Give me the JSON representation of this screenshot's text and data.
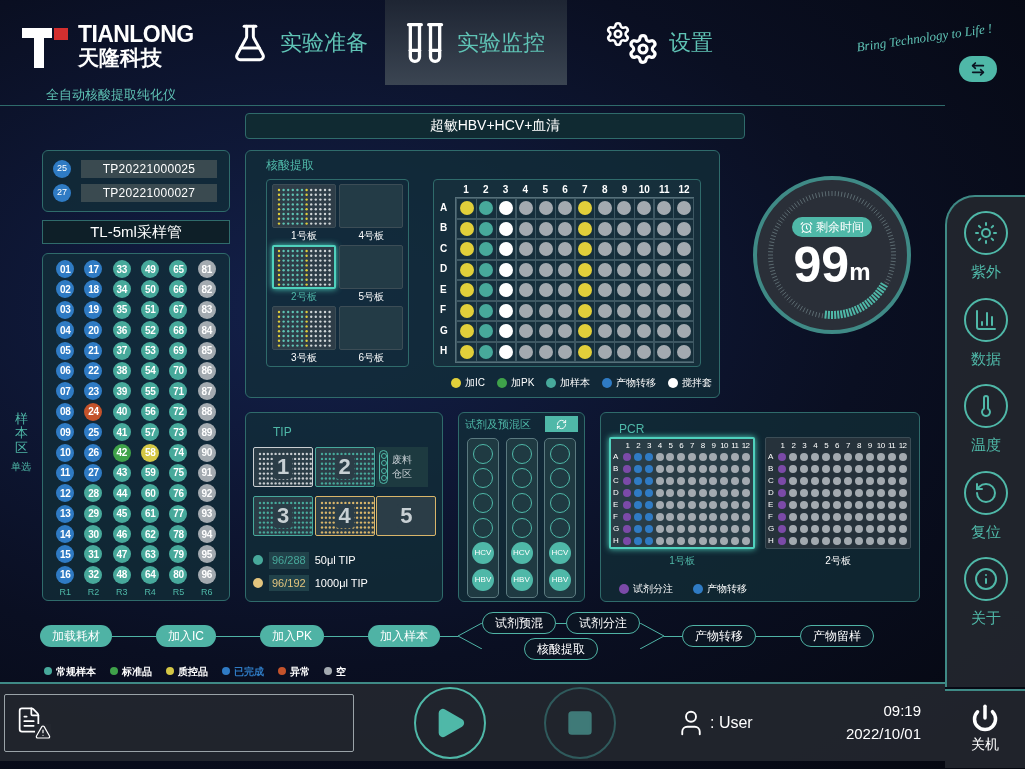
{
  "brand": {
    "name": "TIANLONG",
    "name_cn": "天隆科技",
    "tagline": "Bring Technology to Life !",
    "subtitle": "全自动核酸提取纯化仪"
  },
  "nav": [
    {
      "label": "实验准备",
      "kind": "flask",
      "selected": false
    },
    {
      "label": "实验监控",
      "kind": "tubes",
      "selected": true
    },
    {
      "label": "设置",
      "kind": "gears",
      "selected": false
    }
  ],
  "banner": "超敏HBV+HCV+血清",
  "barcodes": [
    {
      "number": "25",
      "code": "TP20221000025",
      "color": "#2f7bc4"
    },
    {
      "number": "27",
      "code": "TP20221000027",
      "color": "#2f7bc4"
    }
  ],
  "tube_type": "TL-5ml采样管",
  "samples": {
    "side_label": "样本区",
    "mode": "单选",
    "columns": [
      {
        "label": "R1",
        "wells": [
          {
            "label": "01",
            "color": "#2f7bc4"
          },
          {
            "label": "02",
            "color": "#2f7bc4"
          },
          {
            "label": "03",
            "color": "#2f7bc4"
          },
          {
            "label": "04",
            "color": "#2f7bc4"
          },
          {
            "label": "05",
            "color": "#2f7bc4"
          },
          {
            "label": "06",
            "color": "#2f7bc4"
          },
          {
            "label": "07",
            "color": "#2f7bc4"
          },
          {
            "label": "08",
            "color": "#2f7bc4"
          },
          {
            "label": "09",
            "color": "#2f7bc4"
          },
          {
            "label": "10",
            "color": "#2f7bc4"
          },
          {
            "label": "11",
            "color": "#2f7bc4"
          },
          {
            "label": "12",
            "color": "#2f7bc4"
          },
          {
            "label": "13",
            "color": "#2f7bc4"
          },
          {
            "label": "14",
            "color": "#2f7bc4"
          },
          {
            "label": "15",
            "color": "#2f7bc4"
          },
          {
            "label": "16",
            "color": "#2f7bc4"
          }
        ]
      },
      {
        "label": "R2",
        "wells": [
          {
            "label": "17",
            "color": "#2f7bc4"
          },
          {
            "label": "18",
            "color": "#2f7bc4"
          },
          {
            "label": "19",
            "color": "#2f7bc4"
          },
          {
            "label": "20",
            "color": "#2f7bc4"
          },
          {
            "label": "21",
            "color": "#2f7bc4"
          },
          {
            "label": "22",
            "color": "#2f7bc4"
          },
          {
            "label": "23",
            "color": "#2f7bc4"
          },
          {
            "label": "24",
            "color": "#c4532b"
          },
          {
            "label": "25",
            "color": "#2f7bc4"
          },
          {
            "label": "26",
            "color": "#2f7bc4"
          },
          {
            "label": "27",
            "color": "#2f7bc4"
          },
          {
            "label": "28",
            "color": "#47a99b"
          },
          {
            "label": "29",
            "color": "#47a99b"
          },
          {
            "label": "30",
            "color": "#47a99b"
          },
          {
            "label": "31",
            "color": "#47a99b"
          },
          {
            "label": "32",
            "color": "#47a99b"
          }
        ]
      },
      {
        "label": "R3",
        "wells": [
          {
            "label": "33",
            "color": "#47a99b"
          },
          {
            "label": "34",
            "color": "#47a99b"
          },
          {
            "label": "35",
            "color": "#47a99b"
          },
          {
            "label": "36",
            "color": "#47a99b"
          },
          {
            "label": "37",
            "color": "#47a99b"
          },
          {
            "label": "38",
            "color": "#47a99b"
          },
          {
            "label": "39",
            "color": "#47a99b"
          },
          {
            "label": "40",
            "color": "#47a99b"
          },
          {
            "label": "41",
            "color": "#47a99b"
          },
          {
            "label": "42",
            "color": "#3fa24a"
          },
          {
            "label": "43",
            "color": "#47a99b"
          },
          {
            "label": "44",
            "color": "#47a99b"
          },
          {
            "label": "45",
            "color": "#47a99b"
          },
          {
            "label": "46",
            "color": "#47a99b"
          },
          {
            "label": "47",
            "color": "#47a99b"
          },
          {
            "label": "48",
            "color": "#47a99b"
          }
        ]
      },
      {
        "label": "R4",
        "wells": [
          {
            "label": "49",
            "color": "#47a99b"
          },
          {
            "label": "50",
            "color": "#47a99b"
          },
          {
            "label": "51",
            "color": "#47a99b"
          },
          {
            "label": "52",
            "color": "#47a99b"
          },
          {
            "label": "53",
            "color": "#47a99b"
          },
          {
            "label": "54",
            "color": "#47a99b"
          },
          {
            "label": "55",
            "color": "#47a99b"
          },
          {
            "label": "56",
            "color": "#47a99b"
          },
          {
            "label": "57",
            "color": "#47a99b"
          },
          {
            "label": "58",
            "color": "#d4c745"
          },
          {
            "label": "59",
            "color": "#47a99b"
          },
          {
            "label": "60",
            "color": "#47a99b"
          },
          {
            "label": "61",
            "color": "#47a99b"
          },
          {
            "label": "62",
            "color": "#47a99b"
          },
          {
            "label": "63",
            "color": "#47a99b"
          },
          {
            "label": "64",
            "color": "#47a99b"
          }
        ]
      },
      {
        "label": "R5",
        "wells": [
          {
            "label": "65",
            "color": "#47a99b"
          },
          {
            "label": "66",
            "color": "#47a99b"
          },
          {
            "label": "67",
            "color": "#47a99b"
          },
          {
            "label": "68",
            "color": "#47a99b"
          },
          {
            "label": "69",
            "color": "#47a99b"
          },
          {
            "label": "70",
            "color": "#47a99b"
          },
          {
            "label": "71",
            "color": "#47a99b"
          },
          {
            "label": "72",
            "color": "#47a99b"
          },
          {
            "label": "73",
            "color": "#47a99b"
          },
          {
            "label": "74",
            "color": "#47a99b"
          },
          {
            "label": "75",
            "color": "#47a99b"
          },
          {
            "label": "76",
            "color": "#47a99b"
          },
          {
            "label": "77",
            "color": "#47a99b"
          },
          {
            "label": "78",
            "color": "#47a99b"
          },
          {
            "label": "79",
            "color": "#47a99b"
          },
          {
            "label": "80",
            "color": "#47a99b"
          }
        ]
      },
      {
        "label": "R6",
        "wells": [
          {
            "label": "81",
            "color": "#a3aab0"
          },
          {
            "label": "82",
            "color": "#a3aab0"
          },
          {
            "label": "83",
            "color": "#a3aab0"
          },
          {
            "label": "84",
            "color": "#a3aab0"
          },
          {
            "label": "85",
            "color": "#a3aab0"
          },
          {
            "label": "86",
            "color": "#a3aab0"
          },
          {
            "label": "87",
            "color": "#a3aab0"
          },
          {
            "label": "88",
            "color": "#a3aab0"
          },
          {
            "label": "89",
            "color": "#a3aab0"
          },
          {
            "label": "90",
            "color": "#a3aab0"
          },
          {
            "label": "91",
            "color": "#a3aab0"
          },
          {
            "label": "92",
            "color": "#a3aab0"
          },
          {
            "label": "93",
            "color": "#a3aab0"
          },
          {
            "label": "94",
            "color": "#a3aab0"
          },
          {
            "label": "95",
            "color": "#a3aab0"
          },
          {
            "label": "96",
            "color": "#a3aab0"
          }
        ]
      }
    ]
  },
  "extraction": {
    "title": "核酸提取",
    "plates": [
      {
        "label": "1号板",
        "loaded": true,
        "selected": false
      },
      {
        "label": "4号板",
        "loaded": false,
        "selected": false
      },
      {
        "label": "2号板",
        "loaded": true,
        "selected": true
      },
      {
        "label": "5号板",
        "loaded": false,
        "selected": false
      },
      {
        "label": "3号板",
        "loaded": true,
        "selected": false
      },
      {
        "label": "6号板",
        "loaded": false,
        "selected": false
      }
    ],
    "plate": {
      "rows": [
        "A",
        "B",
        "C",
        "D",
        "E",
        "F",
        "G",
        "H"
      ],
      "columns": [
        {
          "label": "1",
          "color": "#e1cf3a"
        },
        {
          "label": "2",
          "color": "#47a99b"
        },
        {
          "label": "3",
          "color": "#ffffff"
        },
        {
          "label": "4",
          "color": "#a3aab0"
        },
        {
          "label": "5",
          "color": "#a3aab0"
        },
        {
          "label": "6",
          "color": "#a3aab0"
        },
        {
          "label": "7",
          "color": "#e1cf3a"
        },
        {
          "label": "8",
          "color": "#a3aab0"
        },
        {
          "label": "9",
          "color": "#a3aab0"
        },
        {
          "label": "10",
          "color": "#a3aab0"
        },
        {
          "label": "11",
          "color": "#a3aab0"
        },
        {
          "label": "12",
          "color": "#a3aab0"
        }
      ]
    },
    "legend": [
      {
        "label": "加IC",
        "color": "#e1cf3a"
      },
      {
        "label": "加PK",
        "color": "#3fa24a"
      },
      {
        "label": "加样本",
        "color": "#47a99b"
      },
      {
        "label": "产物转移",
        "color": "#2f7bc4"
      },
      {
        "label": "搅拌套",
        "color": "#ffffff"
      }
    ]
  },
  "timer": {
    "label": "剩余时间",
    "value": "99",
    "unit": "m"
  },
  "tip": {
    "title": "TIP",
    "racks": [
      {
        "label": "1",
        "color": "#c9ced1",
        "loaded": true
      },
      {
        "label": "2",
        "color": "#47a99b",
        "loaded": true
      },
      {
        "label": "3",
        "color": "#47a99b",
        "loaded": true
      },
      {
        "label": "4",
        "color": "#d9b56a",
        "loaded": true
      },
      {
        "label": "5",
        "color": "#d9b56a",
        "loaded": false
      }
    ],
    "waste": "废料仓区",
    "legend": [
      {
        "count": "96/288",
        "label": "50μl TIP",
        "color": "#47a99b"
      },
      {
        "count": "96/192",
        "label": "1000μl TIP",
        "color": "#e3c57e"
      }
    ]
  },
  "reagent": {
    "title": "试剂及预混区",
    "strips": [
      {
        "slots": [
          {
            "kind": "empty"
          },
          {
            "kind": "empty"
          },
          {
            "kind": "empty"
          },
          {
            "kind": "empty"
          },
          {
            "kind": "reagent",
            "label": "HCV"
          },
          {
            "kind": "reagent",
            "label": "HBV"
          }
        ]
      },
      {
        "slots": [
          {
            "kind": "empty"
          },
          {
            "kind": "empty"
          },
          {
            "kind": "empty"
          },
          {
            "kind": "empty"
          },
          {
            "kind": "reagent",
            "label": "HCV"
          },
          {
            "kind": "reagent",
            "label": "HBV"
          }
        ]
      },
      {
        "slots": [
          {
            "kind": "empty"
          },
          {
            "kind": "empty"
          },
          {
            "kind": "empty"
          },
          {
            "kind": "empty"
          },
          {
            "kind": "reagent",
            "label": "HCV"
          },
          {
            "kind": "reagent",
            "label": "HBV"
          }
        ]
      }
    ]
  },
  "pcr": {
    "title": "PCR",
    "plates": [
      {
        "label": "1号板",
        "selected": true,
        "rows": [
          "A",
          "B",
          "C",
          "D",
          "E",
          "F",
          "G",
          "H"
        ],
        "columns": [
          {
            "label": "1",
            "color": "#7b4aa8"
          },
          {
            "label": "2",
            "color": "#2f7bc4"
          },
          {
            "label": "3",
            "color": "#2f7bc4"
          },
          {
            "label": "4",
            "color": "#a3aab0"
          },
          {
            "label": "5",
            "color": "#a3aab0"
          },
          {
            "label": "6",
            "color": "#a3aab0"
          },
          {
            "label": "7",
            "color": "#a3aab0"
          },
          {
            "label": "8",
            "color": "#a3aab0"
          },
          {
            "label": "9",
            "color": "#a3aab0"
          },
          {
            "label": "10",
            "color": "#a3aab0"
          },
          {
            "label": "11",
            "color": "#a3aab0"
          },
          {
            "label": "12",
            "color": "#a3aab0"
          }
        ]
      },
      {
        "label": "2号板",
        "selected": false,
        "rows": [
          "A",
          "B",
          "C",
          "D",
          "E",
          "F",
          "G",
          "H"
        ],
        "columns": [
          {
            "label": "1",
            "color": "#7b4aa8"
          },
          {
            "label": "2",
            "color": "#a3aab0"
          },
          {
            "label": "3",
            "color": "#a3aab0"
          },
          {
            "label": "4",
            "color": "#a3aab0"
          },
          {
            "label": "5",
            "color": "#a3aab0"
          },
          {
            "label": "6",
            "color": "#a3aab0"
          },
          {
            "label": "7",
            "color": "#a3aab0"
          },
          {
            "label": "8",
            "color": "#a3aab0"
          },
          {
            "label": "9",
            "color": "#a3aab0"
          },
          {
            "label": "10",
            "color": "#a3aab0"
          },
          {
            "label": "11",
            "color": "#a3aab0"
          },
          {
            "label": "12",
            "color": "#a3aab0"
          }
        ]
      }
    ],
    "legend": [
      {
        "label": "试剂分注",
        "color": "#7b4aa8"
      },
      {
        "label": "产物转移",
        "color": "#2f7bc4"
      }
    ]
  },
  "flow": [
    {
      "kind": "step",
      "label": "加载耗材",
      "done": true
    },
    {
      "kind": "step",
      "label": "加入IC",
      "done": true
    },
    {
      "kind": "step",
      "label": "加入PK",
      "done": true
    },
    {
      "kind": "step",
      "label": "加入样本",
      "done": true
    },
    {
      "kind": "branch",
      "upper": [
        {
          "label": "试剂预混",
          "done": false
        },
        {
          "label": "试剂分注",
          "done": false
        }
      ],
      "lower": [
        {
          "label": "核酸提取",
          "done": false
        }
      ]
    },
    {
      "kind": "step",
      "label": "产物转移",
      "done": false
    },
    {
      "kind": "step",
      "label": "产物留样",
      "done": false
    }
  ],
  "sample_legend": [
    {
      "label": "常规样本",
      "color": "#47a99b",
      "highlight": false
    },
    {
      "label": "标准品",
      "color": "#3fa24a",
      "highlight": false
    },
    {
      "label": "质控品",
      "color": "#d4c745",
      "highlight": false
    },
    {
      "label": "已完成",
      "color": "#2f7bc4",
      "highlight": true
    },
    {
      "label": "异常",
      "color": "#c4532b",
      "highlight": false
    },
    {
      "label": "空",
      "color": "#a3aab0",
      "highlight": false
    }
  ],
  "sidebar": [
    {
      "label": "紫外",
      "kind": "sun"
    },
    {
      "label": "数据",
      "kind": "chart"
    },
    {
      "label": "温度",
      "kind": "thermometer"
    },
    {
      "label": "复位",
      "kind": "reset"
    },
    {
      "label": "关于",
      "kind": "info"
    }
  ],
  "controls": {
    "play_enabled": true,
    "stop_enabled": false
  },
  "user": {
    "prefix": ":",
    "name": "User"
  },
  "clock": {
    "time": "09:19",
    "date": "2022/10/01"
  },
  "power": "关机"
}
